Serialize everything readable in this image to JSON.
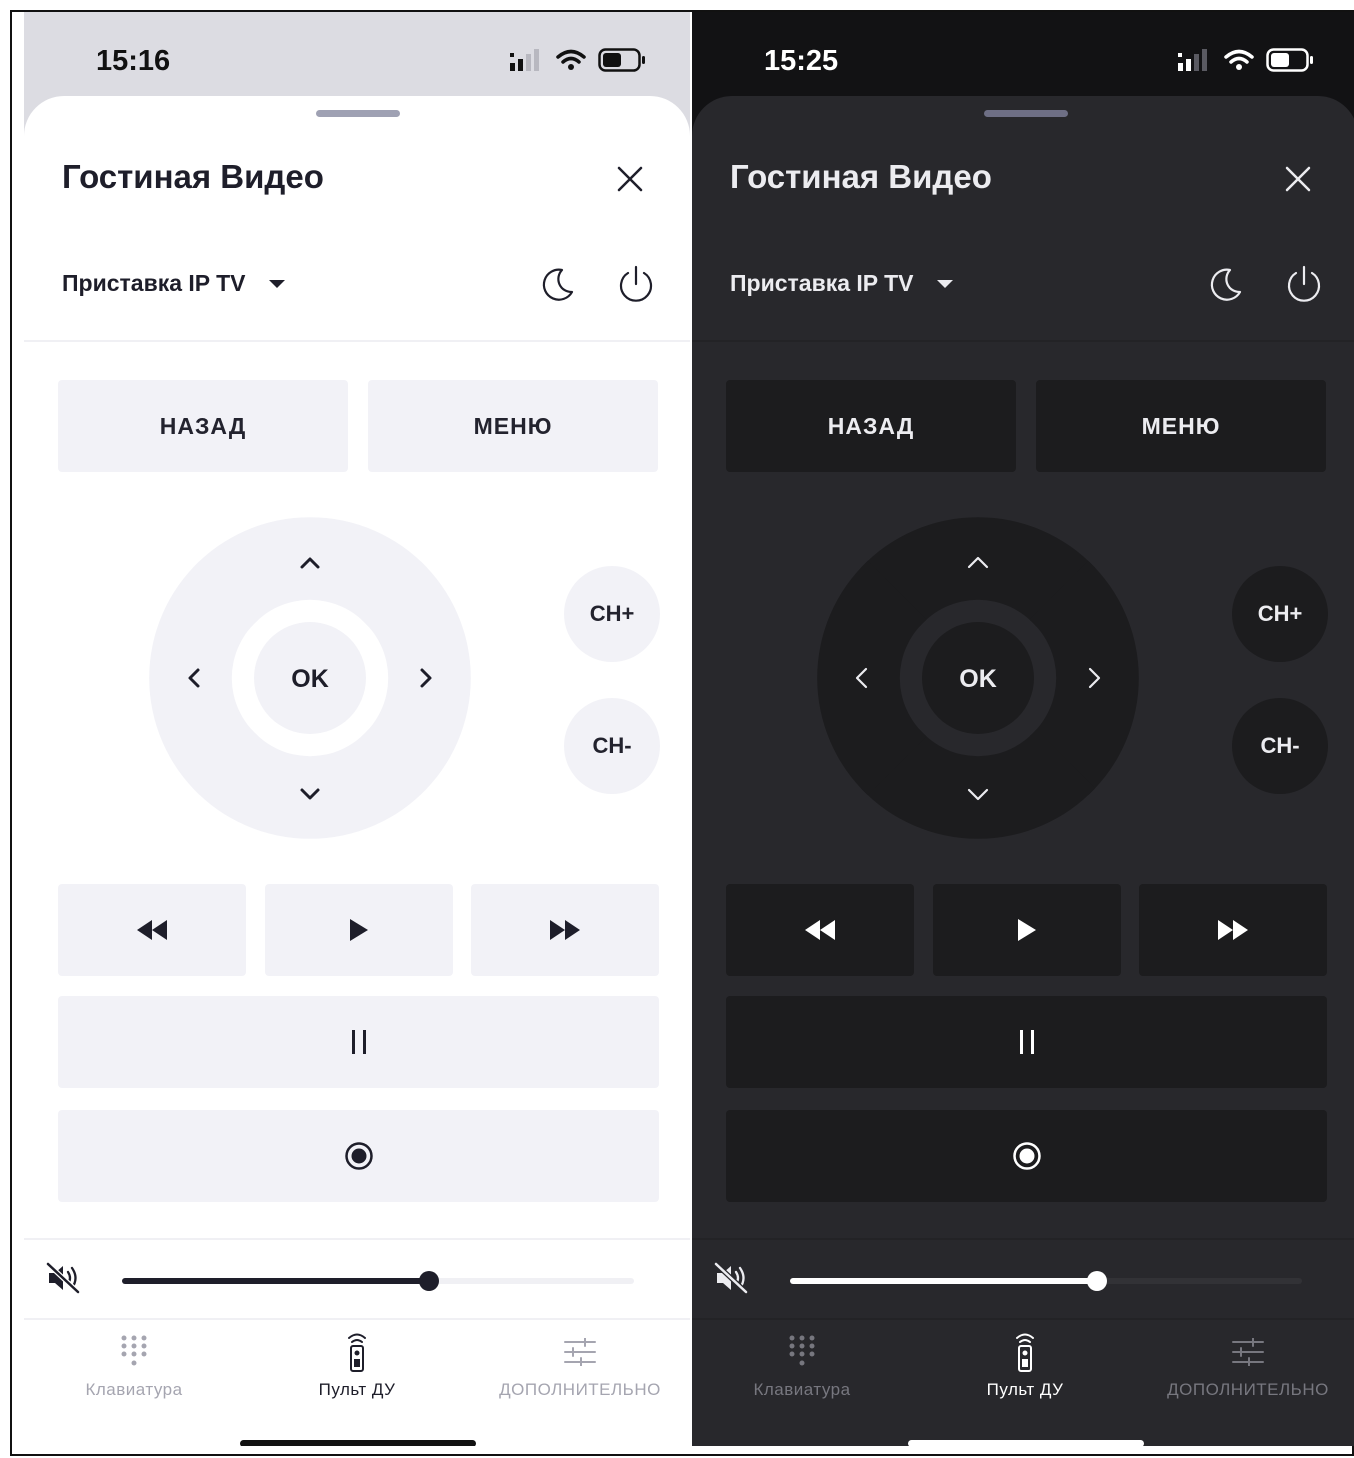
{
  "screens": [
    {
      "theme": "light",
      "status_time": "15:16",
      "title": "Гостиная Видео",
      "device_label": "Приставка IP TV",
      "back_label": "НАЗАД",
      "menu_label": "МЕНЮ",
      "ok_label": "OK",
      "ch_up_label": "CH+",
      "ch_down_label": "CH-",
      "volume_percent": 60,
      "tabs": [
        "Клавиатура",
        "Пульт ДУ",
        "ДОПОЛНИТЕЛЬНО"
      ],
      "active_tab": "Пульт ДУ"
    },
    {
      "theme": "dark",
      "status_time": "15:25",
      "title": "Гостиная Видео",
      "device_label": "Приставка IP TV",
      "back_label": "НАЗАД",
      "menu_label": "МЕНЮ",
      "ok_label": "OK",
      "ch_up_label": "CH+",
      "ch_down_label": "CH-",
      "volume_percent": 60,
      "tabs": [
        "Клавиатура",
        "Пульт ДУ",
        "ДОПОЛНИТЕЛЬНО"
      ],
      "active_tab": "Пульт ДУ"
    }
  ],
  "icons": [
    "signal-icon",
    "wifi-icon",
    "battery-icon",
    "close-icon",
    "dropdown-arrow-icon",
    "moon-icon",
    "power-icon",
    "arrow-up-icon",
    "arrow-down-icon",
    "arrow-left-icon",
    "arrow-right-icon",
    "rewind-icon",
    "play-icon",
    "fast-forward-icon",
    "pause-icon",
    "record-icon",
    "mute-icon",
    "keypad-icon",
    "remote-icon",
    "settings-sliders-icon"
  ],
  "colors": {
    "light_sheet": "#ffffff",
    "light_button": "#f2f2f7",
    "light_text": "#1e1e2a",
    "dark_sheet": "#28282c",
    "dark_button": "#1c1c1e",
    "dark_text": "#ececf0"
  }
}
